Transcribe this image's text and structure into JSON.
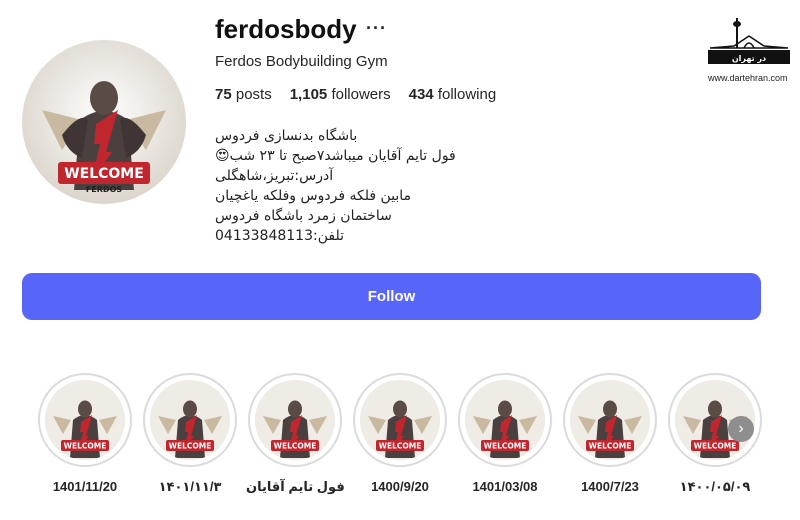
{
  "profile": {
    "username": "ferdosbody",
    "more_icon": "more-horizontal-icon",
    "more_label": "···",
    "full_name": "Ferdos Bodybuilding Gym",
    "avatar_text": {
      "main": "WELCOME",
      "sub": "FERDOS"
    }
  },
  "stats": {
    "posts_count": "75",
    "posts_label": "posts",
    "followers_count": "1,105",
    "followers_label": "followers",
    "following_count": "434",
    "following_label": "following"
  },
  "bio": {
    "line1": "باشگاه بدنسازی فردوس",
    "line2": "فول تایم آقایان میباشد۷صبح تا ۲۳ شب",
    "line2_emoji": "😍",
    "line3": "آدرس:تبریز،شاهگلی",
    "line4": "مابین فلکه فردوس وفلکه یاغچیان",
    "line5": "ساختمان زمرد باشگاه فردوس",
    "line6": "تلفن:04133848113"
  },
  "logo": {
    "caption": "www.dartehran.com",
    "text": "در تهران"
  },
  "actions": {
    "follow_label": "Follow"
  },
  "colors": {
    "follow_bg": "#5865f9",
    "ring": "#dbdbdb",
    "accent_red": "#c0262d"
  },
  "highlights": [
    {
      "label": "1401/11/20"
    },
    {
      "label": "۱۴۰۱/۱۱/۳"
    },
    {
      "label": "فول تایم آقایان"
    },
    {
      "label": "1400/9/20"
    },
    {
      "label": "1401/03/08"
    },
    {
      "label": "1400/7/23"
    },
    {
      "label": "۱۴۰۰/۰۵/۰۹"
    }
  ],
  "highlight_image_text": "WELCOME",
  "next_icon": "chevron-right-icon",
  "next_label": "›"
}
